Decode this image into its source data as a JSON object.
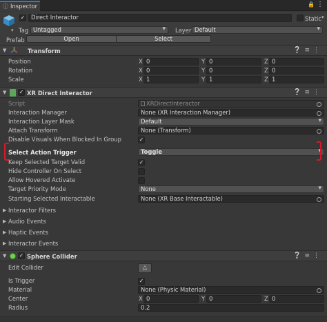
{
  "tab": {
    "label": "Inspector"
  },
  "gameobject": {
    "active": true,
    "name": "Direct Interactor",
    "static_label": "Static",
    "tag_label": "Tag",
    "tag_value": "Untagged",
    "layer_label": "Layer",
    "layer_value": "Default",
    "prefab_label": "Prefab",
    "open_label": "Open",
    "select_label": "Select"
  },
  "transform": {
    "title": "Transform",
    "rows": [
      {
        "label": "Position",
        "x": "0",
        "y": "0",
        "z": "0"
      },
      {
        "label": "Rotation",
        "x": "0",
        "y": "0",
        "z": "0"
      },
      {
        "label": "Scale",
        "x": "1",
        "y": "1",
        "z": "1"
      }
    ],
    "axis": {
      "x": "X",
      "y": "Y",
      "z": "Z"
    }
  },
  "xr": {
    "title": "XR Direct Interactor",
    "enabled": true,
    "script_label": "Script",
    "script_value": "XRDirectInteractor",
    "interaction_manager_label": "Interaction Manager",
    "interaction_manager_value": "None (XR Interaction Manager)",
    "layer_mask_label": "Interaction Layer Mask",
    "layer_mask_value": "Default",
    "attach_label": "Attach Transform",
    "attach_value": "None (Transform)",
    "disable_visuals_label": "Disable Visuals When Blocked In Group",
    "disable_visuals_checked": true,
    "select_trigger_label": "Select Action Trigger",
    "select_trigger_value": "Toggle",
    "keep_selected_label": "Keep Selected Target Valid",
    "keep_selected_checked": true,
    "hide_controller_label": "Hide Controller On Select",
    "hide_controller_checked": false,
    "allow_hovered_label": "Allow Hovered Activate",
    "allow_hovered_checked": false,
    "target_priority_label": "Target Priority Mode",
    "target_priority_value": "None",
    "starting_selected_label": "Starting Selected Interactable",
    "starting_selected_value": "None (XR Base Interactable)",
    "foldouts": [
      "Interactor Filters",
      "Audio Events",
      "Haptic Events",
      "Interactor Events"
    ],
    "highlight_color": "#d8192a"
  },
  "sphere": {
    "title": "Sphere Collider",
    "enabled": true,
    "edit_collider_label": "Edit Collider",
    "is_trigger_label": "Is Trigger",
    "is_trigger_checked": true,
    "material_label": "Material",
    "material_value": "None (Physic Material)",
    "center_label": "Center",
    "center": {
      "x": "0",
      "y": "0",
      "z": "0"
    },
    "radius_label": "Radius",
    "radius_value": "0.2"
  },
  "icons": [
    "lock-icon",
    "menu-icon",
    "cube-icon",
    "help-icon",
    "preset-icon",
    "more-icon",
    "transform-icon",
    "script-icon",
    "sphere-collider-icon",
    "edit-collider-icon",
    "object-picker-icon"
  ]
}
